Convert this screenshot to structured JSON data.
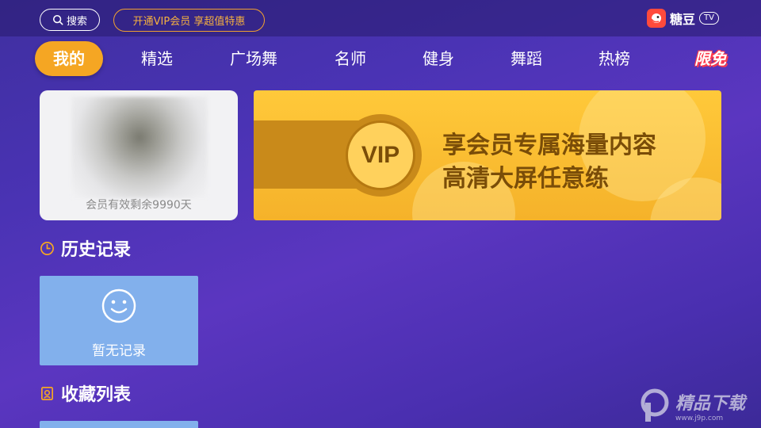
{
  "topbar": {
    "search_label": "搜索",
    "vip_promo_label": "开通VIP会员 享超值特惠",
    "logo_text": "糖豆",
    "logo_badge": "TV"
  },
  "nav": {
    "items": [
      {
        "label": "我的",
        "active": true
      },
      {
        "label": "精选"
      },
      {
        "label": "广场舞"
      },
      {
        "label": "名师"
      },
      {
        "label": "健身"
      },
      {
        "label": "舞蹈"
      },
      {
        "label": "热榜"
      },
      {
        "label": "限免"
      }
    ]
  },
  "profile": {
    "member_status": "会员有效剩余9990天"
  },
  "vip_banner": {
    "badge": "VIP",
    "line1": "享会员专属海量内容",
    "line2": "高清大屏任意练"
  },
  "history": {
    "title": "历史记录",
    "empty_text": "暂无记录"
  },
  "favorites": {
    "title": "收藏列表"
  },
  "watermark": {
    "text": "精品下载",
    "url": "www.j9p.com"
  },
  "colors": {
    "accent": "#f5a623",
    "vip_gold": "#ffc93a",
    "card_blue": "#82b0ec",
    "logo_red": "#ff4a3c"
  }
}
